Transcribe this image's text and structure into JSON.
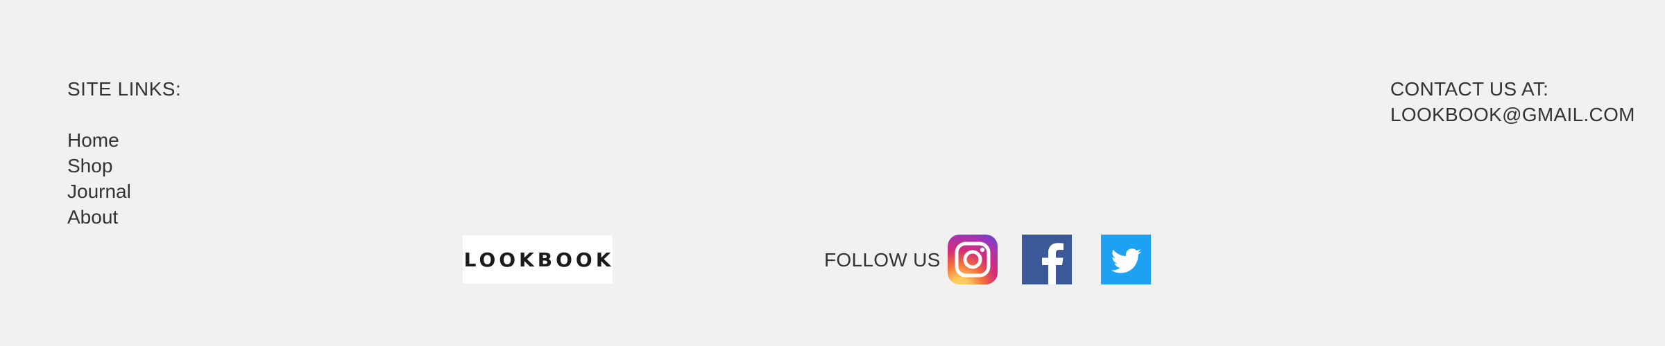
{
  "site_links": {
    "heading": "SITE LINKS:",
    "items": [
      {
        "label": "Home"
      },
      {
        "label": "Shop"
      },
      {
        "label": "Journal"
      },
      {
        "label": "About"
      }
    ]
  },
  "logo": {
    "text": "LOOKBOOK"
  },
  "social": {
    "follow_label": "FOLLOW US",
    "icons": [
      "instagram-icon",
      "facebook-icon",
      "twitter-icon"
    ],
    "colors": {
      "facebook": "#3b5998",
      "twitter": "#1da1f2"
    }
  },
  "contact": {
    "line1": "CONTACT US AT:",
    "email": "LOOKBOOK@GMAIL.COM"
  },
  "colors": {
    "background": "#f1f1f1",
    "text": "#333333"
  }
}
